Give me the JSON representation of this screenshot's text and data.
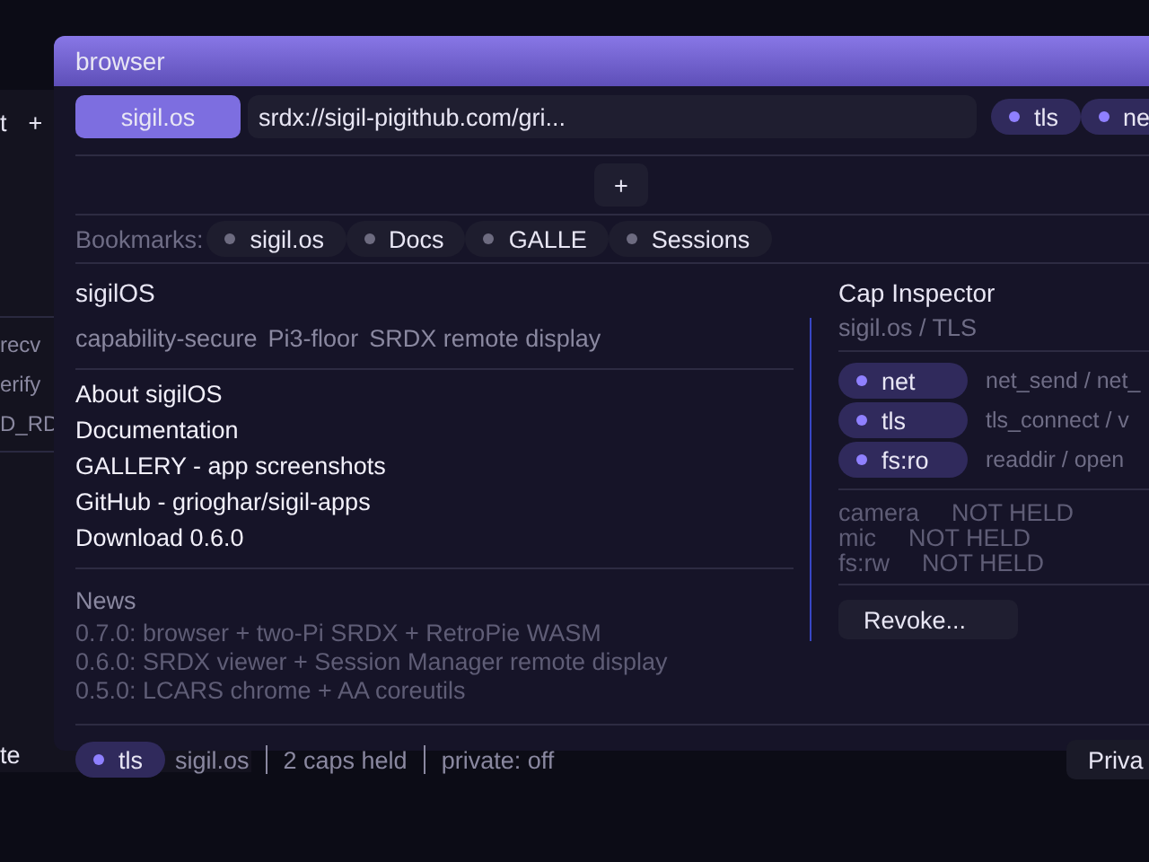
{
  "background_window": {
    "toolbar_text": "t",
    "add_button": "+",
    "rows": [
      {
        "name": "recv"
      },
      {
        "name": "erify"
      },
      {
        "name": "D_RD"
      }
    ],
    "footer_text": "te"
  },
  "window": {
    "title": "browser"
  },
  "tab": {
    "label": "sigil.os",
    "selected": true
  },
  "address_bar": {
    "value": "srdx://sigil-pigithub.com/gri..."
  },
  "cap_chips": [
    {
      "label": "tls"
    },
    {
      "label": "ne"
    }
  ],
  "new_tab_button": "+",
  "bookmarks": {
    "label": "Bookmarks:",
    "items": [
      "sigil.os",
      "Docs",
      "GALLE",
      "Sessions"
    ]
  },
  "page": {
    "title": "sigilOS",
    "tagline": [
      "capability-secure",
      "Pi3-floor",
      "SRDX remote display"
    ],
    "links": [
      "About sigilOS",
      "Documentation",
      "GALLERY - app screenshots",
      "GitHub - grioghar/sigil-apps",
      "Download 0.6.0"
    ],
    "news": {
      "heading": "News",
      "items": [
        "0.7.0: browser + two-Pi SRDX + RetroPie WASM",
        "0.6.0: SRDX viewer + Session Manager remote display",
        "0.5.0: LCARS chrome + AA coreutils"
      ]
    }
  },
  "cap_inspector": {
    "title": "Cap Inspector",
    "subtitle": "sigil.os / TLS",
    "held": [
      {
        "cap": "net",
        "calls": "net_send / net_"
      },
      {
        "cap": "tls",
        "calls": "tls_connect / v"
      },
      {
        "cap": "fs:ro",
        "calls": "readdir / open"
      }
    ],
    "not_held": [
      {
        "cap": "camera",
        "status": "NOT HELD"
      },
      {
        "cap": "mic",
        "status": "NOT HELD"
      },
      {
        "cap": "fs:rw",
        "status": "NOT HELD"
      }
    ],
    "revoke_button": "Revoke..."
  },
  "status_bar": {
    "cap": "tls",
    "items": [
      "sigil.os",
      "2 caps held",
      "private: off"
    ],
    "private_button": "Priva"
  }
}
